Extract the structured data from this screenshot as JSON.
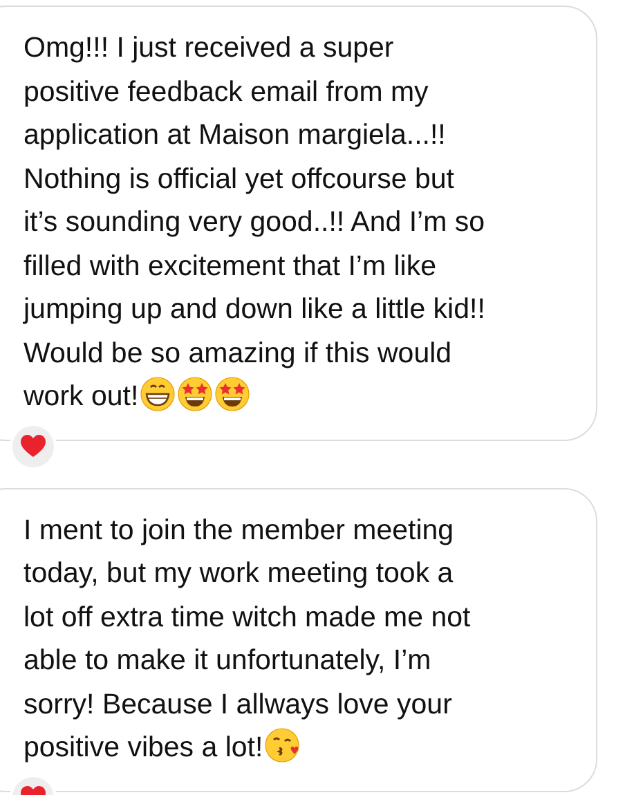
{
  "messages": [
    {
      "lines": [
        "Omg!!! I just received a super",
        "positive feedback email from my",
        "application at Maison margiela...!!",
        "Nothing is official yet offcourse but",
        "it’s sounding very good..!! And I’m so",
        "filled with excitement that I’m like",
        "jumping up and down like a little kid!!",
        "Would be so amazing if this would",
        "work out!"
      ],
      "emojis": [
        {
          "kind": "grin"
        },
        {
          "kind": "star-struck"
        },
        {
          "kind": "star-struck"
        }
      ],
      "reaction": {
        "kind": "heart"
      }
    },
    {
      "lines": [
        "I ment to join the member meeting",
        "today, but my work meeting took a",
        "lot off extra time witch made me not",
        "able to make it unfortunately, I’m",
        "sorry! Because I allways love your",
        "positive vibes a lot!"
      ],
      "emojis": [
        {
          "kind": "kiss"
        }
      ],
      "reaction": {
        "kind": "heart"
      }
    }
  ]
}
